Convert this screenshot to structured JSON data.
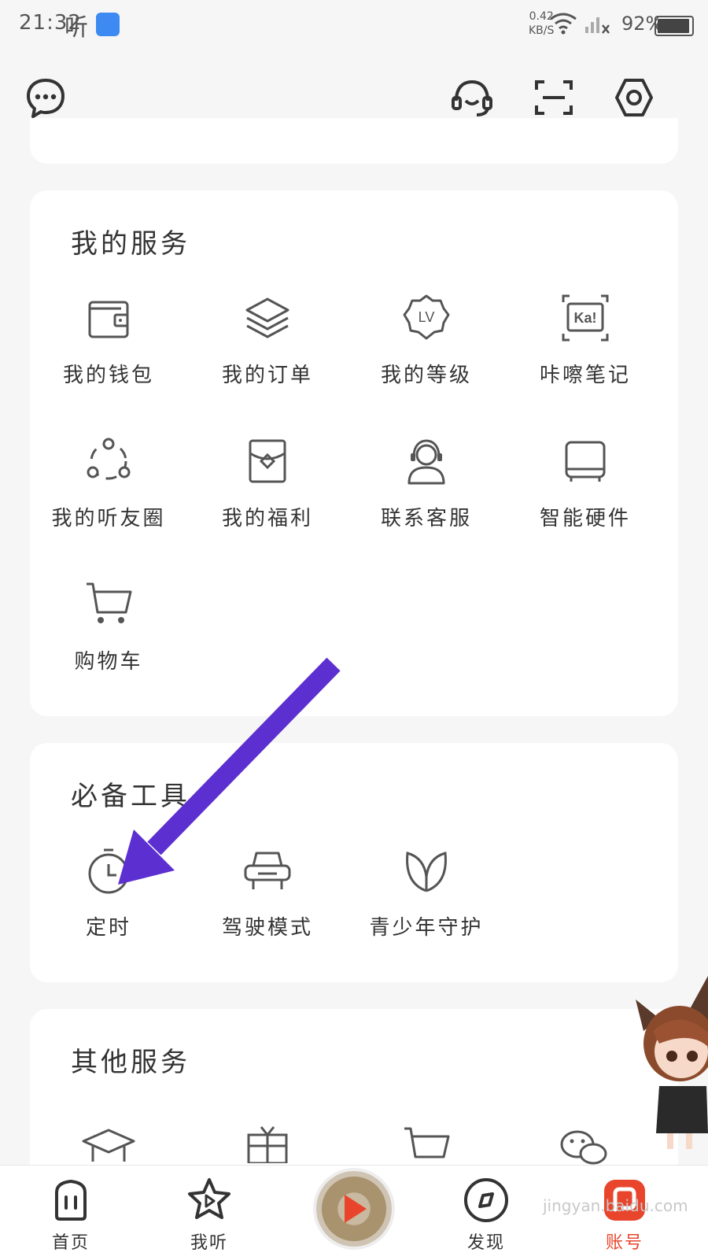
{
  "status": {
    "time": "21:32",
    "app": "听",
    "speed": "0.42",
    "speed_unit": "KB/S",
    "battery": "92%"
  },
  "header": {
    "left_icon": "chat-bubble-icon",
    "icons": [
      "headset-icon",
      "scan-icon",
      "settings-icon"
    ]
  },
  "my_services": {
    "title": "我的服务",
    "items": [
      {
        "label": "我的钱包",
        "icon": "wallet-icon"
      },
      {
        "label": "我的订单",
        "icon": "layers-icon"
      },
      {
        "label": "我的等级",
        "icon": "level-badge-icon",
        "badge": "LV"
      },
      {
        "label": "咔嚓笔记",
        "icon": "ka-note-icon",
        "badge": "Ka!"
      },
      {
        "label": "我的听友圈",
        "icon": "friends-circle-icon"
      },
      {
        "label": "我的福利",
        "icon": "gift-envelope-icon"
      },
      {
        "label": "联系客服",
        "icon": "customer-service-icon"
      },
      {
        "label": "智能硬件",
        "icon": "smart-device-icon"
      },
      {
        "label": "购物车",
        "icon": "cart-icon"
      }
    ]
  },
  "tools": {
    "title": "必备工具",
    "items": [
      {
        "label": "定时",
        "icon": "timer-icon"
      },
      {
        "label": "驾驶模式",
        "icon": "car-icon"
      },
      {
        "label": "青少年守护",
        "icon": "leaf-icon"
      }
    ]
  },
  "other_services": {
    "title": "其他服务",
    "icons": [
      "graduation-cap-icon",
      "gift-box-icon",
      "cart-icon",
      "wechat-icon"
    ]
  },
  "tabbar": {
    "items": [
      {
        "label": "首页",
        "icon": "home-icon"
      },
      {
        "label": "我听",
        "icon": "star-play-icon"
      },
      {
        "label": "发现",
        "icon": "discover-icon"
      },
      {
        "label": "账号",
        "icon": "account-icon",
        "active": true
      }
    ],
    "accent": "#e8452c"
  },
  "watermark": "jingyan.baidu.com",
  "annotation_color": "#5b2fd0"
}
